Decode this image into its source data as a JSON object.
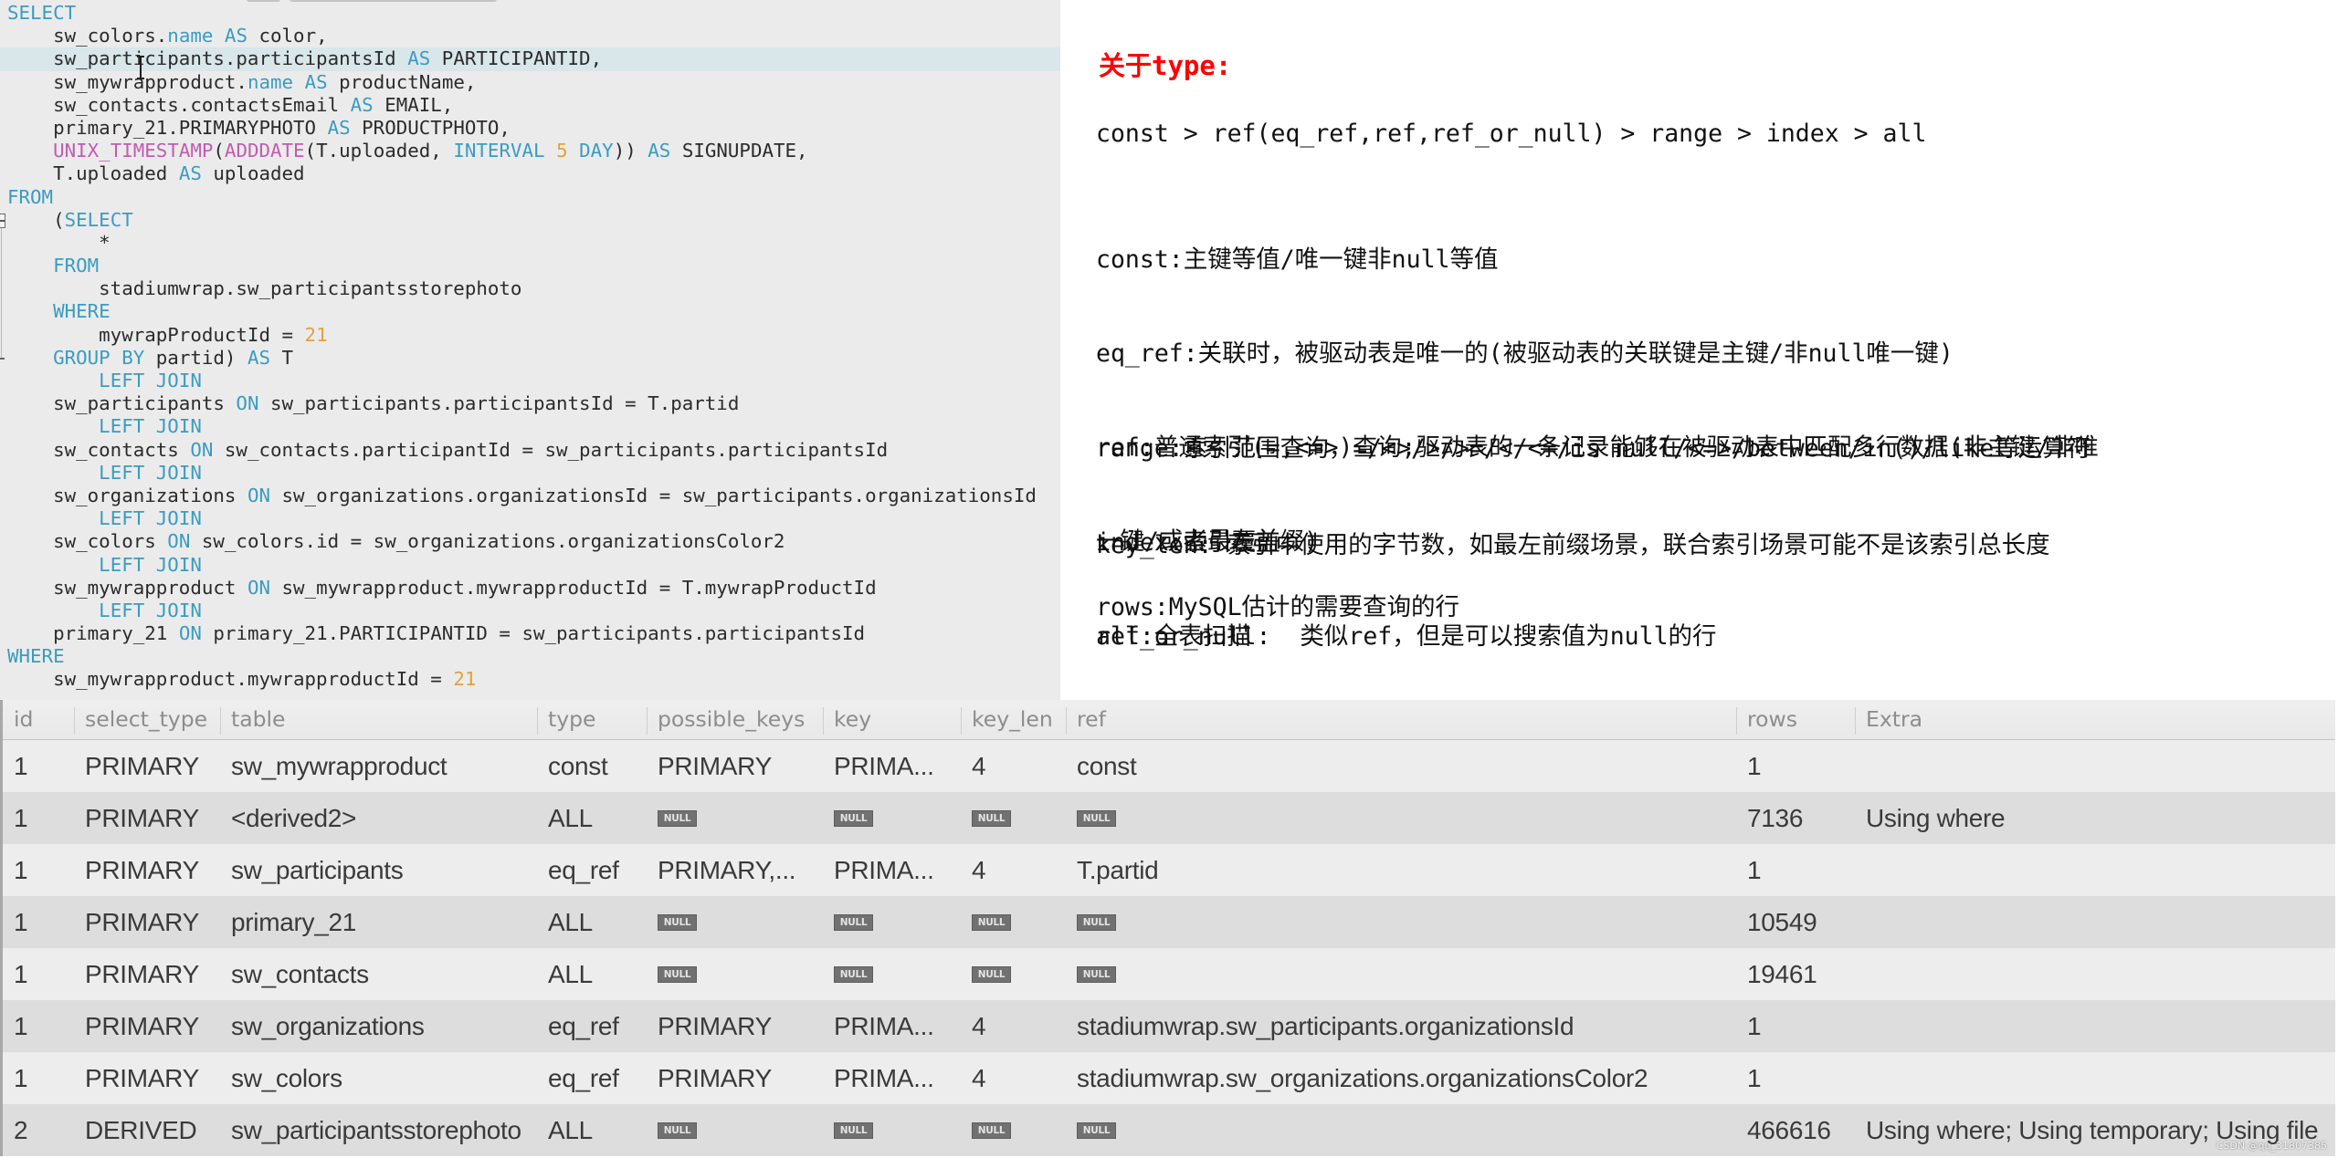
{
  "colors": {
    "keyword": "#3a9cc0",
    "function": "#c05cb0",
    "number": "#e0a143",
    "code_text": "#2b2b2b",
    "editor_bg": "#ebebeb",
    "current_line_bg": "#d9e6ea",
    "note_title": "#ff0000",
    "note_text": "#111111",
    "null_badge_bg": "#717171",
    "row_odd": "#ededed",
    "row_even": "#dddddd"
  },
  "editor": {
    "current_line": 3,
    "lines": [
      [
        [
          "kw",
          "SELECT"
        ]
      ],
      [
        [
          "tx",
          "    sw_colors."
        ],
        [
          "kw",
          "name"
        ],
        [
          "tx",
          " "
        ],
        [
          "kw",
          "AS"
        ],
        [
          "tx",
          " color,"
        ]
      ],
      [
        [
          "tx",
          "    sw_participants.participantsId "
        ],
        [
          "kw",
          "AS"
        ],
        [
          "tx",
          " PARTICIPANTID,"
        ]
      ],
      [
        [
          "tx",
          "    sw_mywrapproduct."
        ],
        [
          "kw",
          "name"
        ],
        [
          "tx",
          " "
        ],
        [
          "kw",
          "AS"
        ],
        [
          "tx",
          " productName,"
        ]
      ],
      [
        [
          "tx",
          "    sw_contacts.contactsEmail "
        ],
        [
          "kw",
          "AS"
        ],
        [
          "tx",
          " EMAIL,"
        ]
      ],
      [
        [
          "tx",
          "    primary_21.PRIMARYPHOTO "
        ],
        [
          "kw",
          "AS"
        ],
        [
          "tx",
          " PRODUCTPHOTO,"
        ]
      ],
      [
        [
          "tx",
          "    "
        ],
        [
          "fn",
          "UNIX_TIMESTAMP"
        ],
        [
          "tx",
          "("
        ],
        [
          "fn",
          "ADDDATE"
        ],
        [
          "tx",
          "(T.uploaded, "
        ],
        [
          "kw",
          "INTERVAL"
        ],
        [
          "tx",
          " "
        ],
        [
          "num",
          "5"
        ],
        [
          "tx",
          " "
        ],
        [
          "kw",
          "DAY"
        ],
        [
          "tx",
          "))"
        ],
        [
          "tx",
          " "
        ],
        [
          "kw",
          "AS"
        ],
        [
          "tx",
          " SIGNUPDATE,"
        ]
      ],
      [
        [
          "tx",
          "    T.uploaded "
        ],
        [
          "kw",
          "AS"
        ],
        [
          "tx",
          " uploaded"
        ]
      ],
      [
        [
          "kw",
          "FROM"
        ]
      ],
      [
        [
          "tx",
          "    ("
        ],
        [
          "kw",
          "SELECT"
        ]
      ],
      [
        [
          "tx",
          "        *"
        ]
      ],
      [
        [
          "tx",
          "    "
        ],
        [
          "kw",
          "FROM"
        ]
      ],
      [
        [
          "tx",
          "        stadiumwrap.sw_participantsstorephoto"
        ]
      ],
      [
        [
          "tx",
          "    "
        ],
        [
          "kw",
          "WHERE"
        ]
      ],
      [
        [
          "tx",
          "        mywrapProductId = "
        ],
        [
          "num",
          "21"
        ]
      ],
      [
        [
          "tx",
          "    "
        ],
        [
          "kw",
          "GROUP BY"
        ],
        [
          "tx",
          " partid) "
        ],
        [
          "kw",
          "AS"
        ],
        [
          "tx",
          " T"
        ]
      ],
      [
        [
          "tx",
          "        "
        ],
        [
          "kw",
          "LEFT JOIN"
        ]
      ],
      [
        [
          "tx",
          "    sw_participants "
        ],
        [
          "kw",
          "ON"
        ],
        [
          "tx",
          " sw_participants.participantsId = T.partid"
        ]
      ],
      [
        [
          "tx",
          "        "
        ],
        [
          "kw",
          "LEFT JOIN"
        ]
      ],
      [
        [
          "tx",
          "    sw_contacts "
        ],
        [
          "kw",
          "ON"
        ],
        [
          "tx",
          " sw_contacts.participantId = sw_participants.participantsId"
        ]
      ],
      [
        [
          "tx",
          "        "
        ],
        [
          "kw",
          "LEFT JOIN"
        ]
      ],
      [
        [
          "tx",
          "    sw_organizations "
        ],
        [
          "kw",
          "ON"
        ],
        [
          "tx",
          " sw_organizations.organizationsId = sw_participants.organizationsId"
        ]
      ],
      [
        [
          "tx",
          "        "
        ],
        [
          "kw",
          "LEFT JOIN"
        ]
      ],
      [
        [
          "tx",
          "    sw_colors "
        ],
        [
          "kw",
          "ON"
        ],
        [
          "tx",
          " sw_colors.id = sw_organizations.organizationsColor2"
        ]
      ],
      [
        [
          "tx",
          "        "
        ],
        [
          "kw",
          "LEFT JOIN"
        ]
      ],
      [
        [
          "tx",
          "    sw_mywrapproduct "
        ],
        [
          "kw",
          "ON"
        ],
        [
          "tx",
          " sw_mywrapproduct.mywrapproductId = T.mywrapProductId"
        ]
      ],
      [
        [
          "tx",
          "        "
        ],
        [
          "kw",
          "LEFT JOIN"
        ]
      ],
      [
        [
          "tx",
          "    primary_21 "
        ],
        [
          "kw",
          "ON"
        ],
        [
          "tx",
          " primary_21.PARTICIPANTID = sw_participants.participantsId"
        ]
      ],
      [
        [
          "kw",
          "WHERE"
        ]
      ],
      [
        [
          "tx",
          "    sw_mywrapproduct.mywrapproductId = "
        ],
        [
          "num",
          "21"
        ]
      ]
    ]
  },
  "notes": {
    "title": "关于type:",
    "type_order": "const > ref(eq_ref,ref,ref_or_null) > range > index > all",
    "type_defs": [
      "const:主键等值/唯一键非null等值",
      "eq_ref:关联时，被驱动表是唯一的(被驱动表的关联键是主键/非null唯一键)",
      "ref:普通索引(=,<=>)查询;驱动表的一条记录能够在被驱动表中匹配多行数据(非主键/非唯",
      "一键/或者最左前缀)",
      "ref_or_null:  类似ref，但是可以搜索值为null的行"
    ],
    "range_defs": [
      "range:索引范围查询，=/<>/>/>=/</<=/is null/<=>/between/in()/like等运算符",
      "index:索引覆盖",
      "all:全表扫描"
    ],
    "key_len": "key_len: 索引中使用的字节数，如最左前缀场景，联合索引场景可能不是该索引总长度",
    "rows": "rows:MySQL估计的需要查询的行"
  },
  "explain": {
    "columns": [
      "id",
      "select_type",
      "table",
      "type",
      "possible_keys",
      "key",
      "key_len",
      "ref",
      "rows",
      "Extra"
    ],
    "null_label": "NULL",
    "rows": [
      [
        "1",
        "PRIMARY",
        "sw_mywrapproduct",
        "const",
        "PRIMARY",
        "PRIMA...",
        "4",
        "const",
        "1",
        ""
      ],
      [
        "1",
        "PRIMARY",
        "<derived2>",
        "ALL",
        null,
        null,
        null,
        null,
        "7136",
        "Using where"
      ],
      [
        "1",
        "PRIMARY",
        "sw_participants",
        "eq_ref",
        "PRIMARY,...",
        "PRIMA...",
        "4",
        "T.partid",
        "1",
        ""
      ],
      [
        "1",
        "PRIMARY",
        "primary_21",
        "ALL",
        null,
        null,
        null,
        null,
        "10549",
        ""
      ],
      [
        "1",
        "PRIMARY",
        "sw_contacts",
        "ALL",
        null,
        null,
        null,
        null,
        "19461",
        ""
      ],
      [
        "1",
        "PRIMARY",
        "sw_organizations",
        "eq_ref",
        "PRIMARY",
        "PRIMA...",
        "4",
        "stadiumwrap.sw_participants.organizationsId",
        "1",
        ""
      ],
      [
        "1",
        "PRIMARY",
        "sw_colors",
        "eq_ref",
        "PRIMARY",
        "PRIMA...",
        "4",
        "stadiumwrap.sw_organizations.organizationsColor2",
        "1",
        ""
      ],
      [
        "2",
        "DERIVED",
        "sw_participantsstorephoto",
        "ALL",
        null,
        null,
        null,
        null,
        "466616",
        "Using where; Using temporary; Using file"
      ]
    ]
  },
  "watermark": "CSDN @qq_31807385"
}
